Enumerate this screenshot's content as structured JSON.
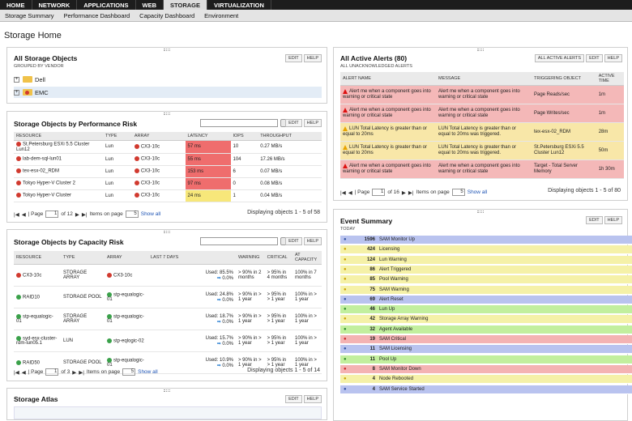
{
  "nav": {
    "tabs": [
      "HOME",
      "NETWORK",
      "APPLICATIONS",
      "WEB",
      "STORAGE",
      "VIRTUALIZATION"
    ],
    "active": "STORAGE",
    "subtabs": [
      "Storage Summary",
      "Performance Dashboard",
      "Capacity Dashboard",
      "Environment"
    ]
  },
  "page": {
    "title": "Storage Home"
  },
  "colors": {
    "red_row": "#f4b8b8",
    "yellow_row": "#f8e7a8",
    "latency_red": "#ef6d6d",
    "latency_yellow": "#f7e77a"
  },
  "all_objects": {
    "title": "All Storage Objects",
    "subtitle": "GROUPED BY VENDOR",
    "edit": "EDIT",
    "help": "HELP",
    "items": [
      "Dell",
      "EMC"
    ]
  },
  "perf": {
    "title": "Storage Objects by Performance Risk",
    "edit": "EDIT",
    "help": "HELP",
    "headers": [
      "RESOURCE",
      "TYPE",
      "ARRAY",
      "LATENCY",
      "IOPS",
      "THROUGHPUT"
    ],
    "rows": [
      {
        "resource": "St.Petersburg ESXi 5.5 Cluster Lun12",
        "type": "Lun",
        "array": "CX3-10c",
        "latency": "57 ms",
        "iops": "10",
        "throughput": "0.27 MB/s",
        "lvl": "red"
      },
      {
        "resource": "lab-dem-sql-lun01",
        "type": "Lun",
        "array": "CX3-10c",
        "latency": "55 ms",
        "iops": "104",
        "throughput": "17.26 MB/s",
        "lvl": "red"
      },
      {
        "resource": "tex-esx-02_RDM",
        "type": "Lun",
        "array": "CX3-10c",
        "latency": "153 ms",
        "iops": "6",
        "throughput": "0.07 MB/s",
        "lvl": "red"
      },
      {
        "resource": "Tokyo Hyper-V Cluster 2",
        "type": "Lun",
        "array": "CX3-10c",
        "latency": "97 ms",
        "iops": "0",
        "throughput": "0.08 MB/s",
        "lvl": "red"
      },
      {
        "resource": "Tokyo Hyper-V Cluster",
        "type": "Lun",
        "array": "CX3-10c",
        "latency": "24 ms",
        "iops": "1",
        "throughput": "0.04 MB/s",
        "lvl": "yel"
      }
    ],
    "pager": {
      "page": "1",
      "of": "of 12",
      "items_label": "Items on page",
      "items": "5",
      "show_all": "Show all",
      "display": "Displaying objects 1 - 5 of 58"
    }
  },
  "cap": {
    "title": "Storage Objects by Capacity Risk",
    "edit": "EDIT",
    "help": "HELP",
    "headers": [
      "RESOURCE",
      "TYPE",
      "ARRAY",
      "LAST 7 DAYS",
      "WARNING",
      "CRITICAL",
      "AT CAPACITY"
    ],
    "rows": [
      {
        "resource": "CX3-10c",
        "type": "STORAGE ARRAY",
        "array": "CX3-10c",
        "used": "Used: 85.5%",
        "chg": "0.0%",
        "warn": "> 90% in 2 months",
        "crit": "> 95% in 4 months",
        "atcap": "100% in 7 months",
        "status": "red"
      },
      {
        "resource": "RAID10",
        "type": "STORAGE POOL",
        "array": "stp-equalogic-01",
        "used": "Used: 24.8%",
        "chg": "0.0%",
        "warn": "> 90% in > 1 year",
        "crit": "> 95% in > 1 year",
        "atcap": "100% in > 1 year",
        "status": "grn"
      },
      {
        "resource": "stp-equalogic-01",
        "type": "STORAGE ARRAY",
        "array": "stp-equalogic-01",
        "used": "Used: 18.7%",
        "chg": "0.0%",
        "warn": "> 90% in > 1 year",
        "crit": "> 95% in > 1 year",
        "atcap": "100% in > 1 year",
        "status": "grn"
      },
      {
        "resource": "syd-esx-cluster-rdm-lun05.1",
        "type": "LUN",
        "array": "stp-eqlogic-02",
        "used": "Used: 15.7%",
        "chg": "0.0%",
        "warn": "> 90% in > 1 year",
        "crit": "> 95% in > 1 year",
        "atcap": "100% in > 1 year",
        "status": "grn"
      },
      {
        "resource": "RAID50",
        "type": "STORAGE POOL",
        "array": "stp-equalogic-01",
        "used": "Used: 10.9%",
        "chg": "0.0%",
        "warn": "> 90% in > 1 year",
        "crit": "> 95% in > 1 year",
        "atcap": "100% in > 1 year",
        "status": "grn"
      }
    ],
    "pager": {
      "page": "1",
      "of": "of 3",
      "items_label": "Items on page",
      "items": "5",
      "show_all": "Show all",
      "display": "Displaying objects 1 - 5 of 14"
    }
  },
  "atlas": {
    "title": "Storage Atlas",
    "edit": "EDIT",
    "help": "HELP"
  },
  "alerts": {
    "title": "All Active Alerts (80)",
    "subtitle": "ALL UNACKNOWLEDGED ALERTS",
    "all_btn": "ALL ACTIVE ALERTS",
    "edit": "EDIT",
    "help": "HELP",
    "headers": [
      "ALERT NAME",
      "MESSAGE",
      "TRIGGERING OBJECT",
      "ACTIVE TIME"
    ],
    "rows": [
      {
        "name": "Alert me when a component goes into warning or critical state",
        "msg": "Alert me when a component goes into warning or critical state",
        "obj": "Page Reads/sec",
        "time": "1m",
        "lvl": "red"
      },
      {
        "name": "Alert me when a component goes into warning or critical state",
        "msg": "Alert me when a component goes into warning or critical state",
        "obj": "Page Writes/sec",
        "time": "1m",
        "lvl": "red"
      },
      {
        "name": "LUN Total Latency is greater than or equal to 20ms",
        "msg": "LUN Total Latency is greater than or equal to 20ms was triggered.",
        "obj": "tex-esx-02_RDM",
        "time": "28m",
        "lvl": "yel"
      },
      {
        "name": "LUN Total Latency is greater than or equal to 20ms",
        "msg": "LUN Total Latency is greater than or equal to 20ms was triggered.",
        "obj": "St.Petersburg ESXi 5.5 Cluster Lun12",
        "time": "50m",
        "lvl": "yel"
      },
      {
        "name": "Alert me when a component goes into warning or critical state",
        "msg": "Alert me when a component goes into warning or critical state",
        "obj": "Target - Total Server Memory",
        "time": "1h 30m",
        "lvl": "red"
      }
    ],
    "pager": {
      "page": "1",
      "of": "of 16",
      "items_label": "Items on page",
      "items": "5",
      "show_all": "Show all",
      "display": "Displaying objects 1 - 5 of 80"
    }
  },
  "events": {
    "title": "Event Summary",
    "subtitle": "TODAY",
    "edit": "EDIT",
    "help": "HELP",
    "rows": [
      {
        "count": "1596",
        "label": "SAM Monitor Up",
        "color": "#b9c3ef",
        "icon": "info-icon"
      },
      {
        "count": "424",
        "label": "Licensing",
        "color": "#f5f1a8",
        "icon": "license-icon"
      },
      {
        "count": "124",
        "label": "Lun Warning",
        "color": "#f5f1a8",
        "icon": "warning-icon"
      },
      {
        "count": "86",
        "label": "Alert Triggered",
        "color": "#f5f1a8",
        "icon": "alert-icon"
      },
      {
        "count": "85",
        "label": "Pool Warning",
        "color": "#f5f1a8",
        "icon": "warning-icon"
      },
      {
        "count": "75",
        "label": "SAM Warning",
        "color": "#f5f1a8",
        "icon": "warning-icon"
      },
      {
        "count": "69",
        "label": "Alert Reset",
        "color": "#b9c3ef",
        "icon": "reset-icon"
      },
      {
        "count": "46",
        "label": "Lun Up",
        "color": "#c2ef9e",
        "icon": "up-icon"
      },
      {
        "count": "42",
        "label": "Storage Array Warning",
        "color": "#f5f1a8",
        "icon": "warning-icon"
      },
      {
        "count": "32",
        "label": "Agent Available",
        "color": "#c2ef9e",
        "icon": "agent-icon"
      },
      {
        "count": "19",
        "label": "SAM Critical",
        "color": "#f4b3b3",
        "icon": "critical-icon"
      },
      {
        "count": "11",
        "label": "SAM Licensing",
        "color": "#b9c3ef",
        "icon": "license-icon"
      },
      {
        "count": "11",
        "label": "Pool Up",
        "color": "#c2ef9e",
        "icon": "up-icon"
      },
      {
        "count": "8",
        "label": "SAM Monitor Down",
        "color": "#f4b3b3",
        "icon": "down-icon"
      },
      {
        "count": "4",
        "label": "Node Rebooted",
        "color": "#f5f1a8",
        "icon": "reboot-icon"
      },
      {
        "count": "4",
        "label": "SAM Service Started",
        "color": "#b9c3ef",
        "icon": "service-icon"
      }
    ]
  }
}
